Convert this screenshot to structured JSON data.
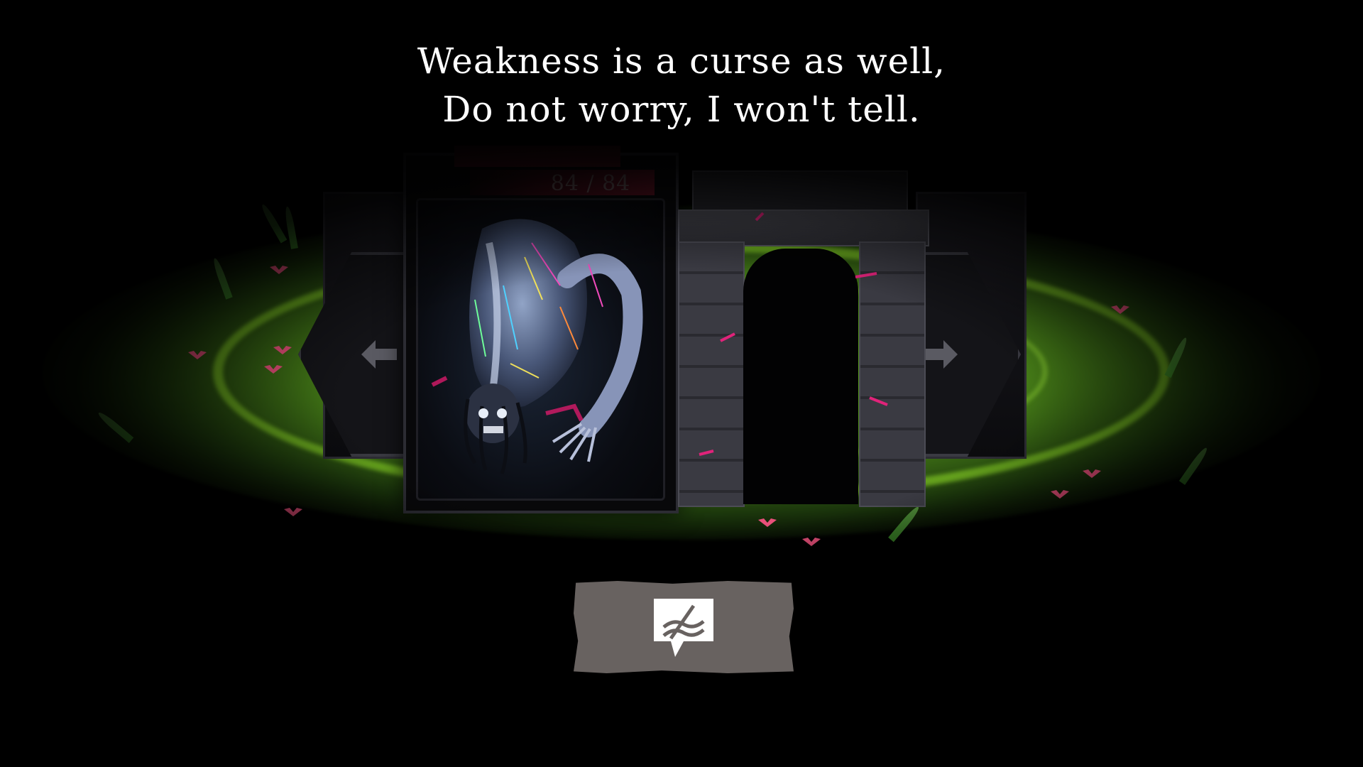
{
  "dialogue": {
    "line1": "Weakness is a curse as well,",
    "line2": "Do not worry, I won't tell."
  },
  "enemy": {
    "hp_text": "84 / 84",
    "hp_fraction": 1.0
  },
  "navigation": {
    "left_icon": "arrow-left-icon",
    "right_icon": "arrow-right-icon"
  },
  "action_button": {
    "icon": "speech-bubble-crossed-icon"
  },
  "colors": {
    "arena_green": "#6ebe28",
    "hp_red": "#5e1222",
    "button_gray": "#686260",
    "flower_pink": "#e8507a",
    "text_white": "#ffffff"
  }
}
